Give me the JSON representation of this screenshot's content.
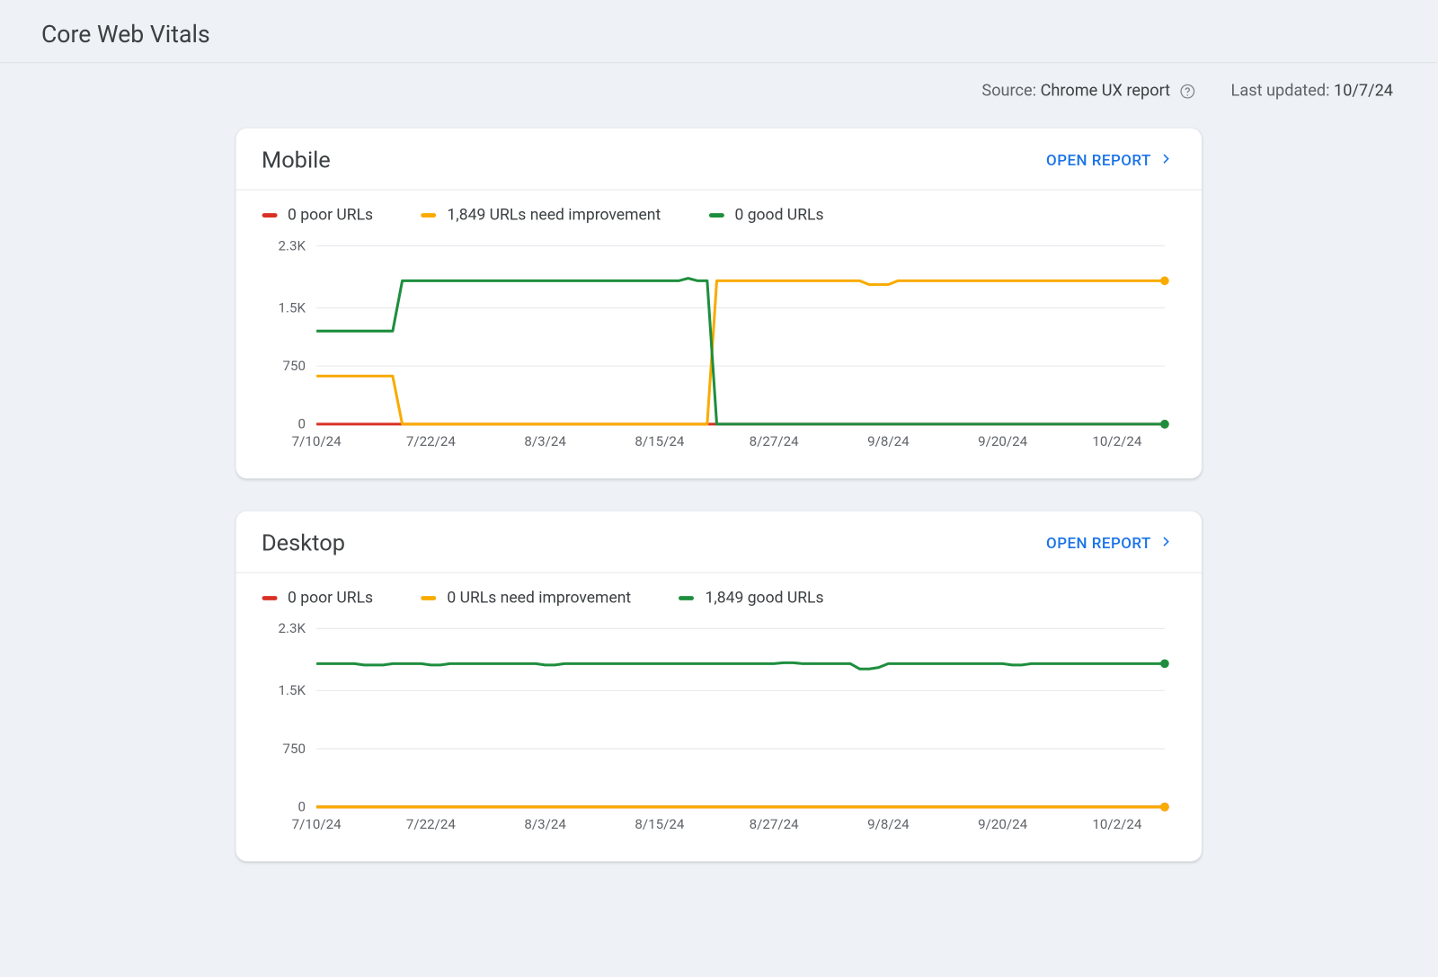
{
  "page_title": "Core Web Vitals",
  "meta": {
    "source_label": "Source:",
    "source_value": "Chrome UX report",
    "last_updated_label": "Last updated:",
    "last_updated_value": "10/7/24"
  },
  "colors": {
    "poor": "#d93025",
    "needs": "#f9ab00",
    "good": "#1e8e3e",
    "link": "#1a73e8",
    "grid": "#e8eaed",
    "axis_text": "#5f6368"
  },
  "y_ticks": [
    "2.3K",
    "1.5K",
    "750",
    "0"
  ],
  "y_tick_values": [
    2300,
    1500,
    750,
    0
  ],
  "x_ticks": [
    "7/10/24",
    "7/22/24",
    "8/3/24",
    "8/15/24",
    "8/27/24",
    "9/8/24",
    "9/20/24",
    "10/2/24"
  ],
  "cards": {
    "mobile": {
      "title": "Mobile",
      "open_report_label": "OPEN REPORT",
      "legend": {
        "poor": "0 poor URLs",
        "needs": "1,849 URLs need improvement",
        "good": "0 good URLs"
      }
    },
    "desktop": {
      "title": "Desktop",
      "open_report_label": "OPEN REPORT",
      "legend": {
        "poor": "0 poor URLs",
        "needs": "0 URLs need improvement",
        "good": "1,849 good URLs"
      }
    }
  },
  "chart_data": [
    {
      "id": "mobile",
      "type": "line",
      "title": "Mobile",
      "xlabel": "",
      "ylabel": "",
      "ylim": [
        0,
        2300
      ],
      "x": [
        "7/10/24",
        "7/11/24",
        "7/12/24",
        "7/13/24",
        "7/14/24",
        "7/15/24",
        "7/16/24",
        "7/17/24",
        "7/18/24",
        "7/19/24",
        "7/20/24",
        "7/21/24",
        "7/22/24",
        "7/23/24",
        "7/24/24",
        "7/25/24",
        "7/26/24",
        "7/27/24",
        "7/28/24",
        "7/29/24",
        "7/30/24",
        "7/31/24",
        "8/1/24",
        "8/2/24",
        "8/3/24",
        "8/4/24",
        "8/5/24",
        "8/6/24",
        "8/7/24",
        "8/8/24",
        "8/9/24",
        "8/10/24",
        "8/11/24",
        "8/12/24",
        "8/13/24",
        "8/14/24",
        "8/15/24",
        "8/16/24",
        "8/17/24",
        "8/18/24",
        "8/19/24",
        "8/20/24",
        "8/21/24",
        "8/22/24",
        "8/23/24",
        "8/24/24",
        "8/25/24",
        "8/26/24",
        "8/27/24",
        "8/28/24",
        "8/29/24",
        "8/30/24",
        "8/31/24",
        "9/1/24",
        "9/2/24",
        "9/3/24",
        "9/4/24",
        "9/5/24",
        "9/6/24",
        "9/7/24",
        "9/8/24",
        "9/9/24",
        "9/10/24",
        "9/11/24",
        "9/12/24",
        "9/13/24",
        "9/14/24",
        "9/15/24",
        "9/16/24",
        "9/17/24",
        "9/18/24",
        "9/19/24",
        "9/20/24",
        "9/21/24",
        "9/22/24",
        "9/23/24",
        "9/24/24",
        "9/25/24",
        "9/26/24",
        "9/27/24",
        "9/28/24",
        "9/29/24",
        "9/30/24",
        "10/1/24",
        "10/2/24",
        "10/3/24",
        "10/4/24",
        "10/5/24",
        "10/6/24",
        "10/7/24"
      ],
      "series": [
        {
          "name": "poor",
          "color": "#d93025",
          "values": [
            0,
            0,
            0,
            0,
            0,
            0,
            0,
            0,
            0,
            0,
            0,
            0,
            0,
            0,
            0,
            0,
            0,
            0,
            0,
            0,
            0,
            0,
            0,
            0,
            0,
            0,
            0,
            0,
            0,
            0,
            0,
            0,
            0,
            0,
            0,
            0,
            0,
            0,
            0,
            0,
            0,
            0,
            0,
            0,
            0,
            0,
            0,
            0,
            0,
            0,
            0,
            0,
            0,
            0,
            0,
            0,
            0,
            0,
            0,
            0,
            0,
            0,
            0,
            0,
            0,
            0,
            0,
            0,
            0,
            0,
            0,
            0,
            0,
            0,
            0,
            0,
            0,
            0,
            0,
            0,
            0,
            0,
            0,
            0,
            0,
            0,
            0,
            0,
            0,
            0
          ]
        },
        {
          "name": "needs_improvement",
          "color": "#f9ab00",
          "values": [
            620,
            620,
            620,
            620,
            620,
            620,
            620,
            620,
            620,
            0,
            0,
            0,
            0,
            0,
            0,
            0,
            0,
            0,
            0,
            0,
            0,
            0,
            0,
            0,
            0,
            0,
            0,
            0,
            0,
            0,
            0,
            0,
            0,
            0,
            0,
            0,
            0,
            0,
            0,
            0,
            0,
            0,
            1849,
            1849,
            1849,
            1849,
            1849,
            1849,
            1849,
            1849,
            1849,
            1849,
            1849,
            1849,
            1849,
            1849,
            1849,
            1849,
            1800,
            1800,
            1800,
            1849,
            1849,
            1849,
            1849,
            1849,
            1849,
            1849,
            1849,
            1849,
            1849,
            1849,
            1849,
            1849,
            1849,
            1849,
            1849,
            1849,
            1849,
            1849,
            1849,
            1849,
            1849,
            1849,
            1849,
            1849,
            1849,
            1849,
            1849,
            1849
          ]
        },
        {
          "name": "good",
          "color": "#1e8e3e",
          "values": [
            1200,
            1200,
            1200,
            1200,
            1200,
            1200,
            1200,
            1200,
            1200,
            1849,
            1849,
            1849,
            1849,
            1849,
            1849,
            1849,
            1849,
            1849,
            1849,
            1849,
            1849,
            1849,
            1849,
            1849,
            1849,
            1849,
            1849,
            1849,
            1849,
            1849,
            1849,
            1849,
            1849,
            1849,
            1849,
            1849,
            1849,
            1849,
            1849,
            1880,
            1849,
            1849,
            0,
            0,
            0,
            0,
            0,
            0,
            0,
            0,
            0,
            0,
            0,
            0,
            0,
            0,
            0,
            0,
            0,
            0,
            0,
            0,
            0,
            0,
            0,
            0,
            0,
            0,
            0,
            0,
            0,
            0,
            0,
            0,
            0,
            0,
            0,
            0,
            0,
            0,
            0,
            0,
            0,
            0,
            0,
            0,
            0,
            0,
            0,
            0
          ]
        }
      ]
    },
    {
      "id": "desktop",
      "type": "line",
      "title": "Desktop",
      "xlabel": "",
      "ylabel": "",
      "ylim": [
        0,
        2300
      ],
      "x": [
        "7/10/24",
        "7/11/24",
        "7/12/24",
        "7/13/24",
        "7/14/24",
        "7/15/24",
        "7/16/24",
        "7/17/24",
        "7/18/24",
        "7/19/24",
        "7/20/24",
        "7/21/24",
        "7/22/24",
        "7/23/24",
        "7/24/24",
        "7/25/24",
        "7/26/24",
        "7/27/24",
        "7/28/24",
        "7/29/24",
        "7/30/24",
        "7/31/24",
        "8/1/24",
        "8/2/24",
        "8/3/24",
        "8/4/24",
        "8/5/24",
        "8/6/24",
        "8/7/24",
        "8/8/24",
        "8/9/24",
        "8/10/24",
        "8/11/24",
        "8/12/24",
        "8/13/24",
        "8/14/24",
        "8/15/24",
        "8/16/24",
        "8/17/24",
        "8/18/24",
        "8/19/24",
        "8/20/24",
        "8/21/24",
        "8/22/24",
        "8/23/24",
        "8/24/24",
        "8/25/24",
        "8/26/24",
        "8/27/24",
        "8/28/24",
        "8/29/24",
        "8/30/24",
        "8/31/24",
        "9/1/24",
        "9/2/24",
        "9/3/24",
        "9/4/24",
        "9/5/24",
        "9/6/24",
        "9/7/24",
        "9/8/24",
        "9/9/24",
        "9/10/24",
        "9/11/24",
        "9/12/24",
        "9/13/24",
        "9/14/24",
        "9/15/24",
        "9/16/24",
        "9/17/24",
        "9/18/24",
        "9/19/24",
        "9/20/24",
        "9/21/24",
        "9/22/24",
        "9/23/24",
        "9/24/24",
        "9/25/24",
        "9/26/24",
        "9/27/24",
        "9/28/24",
        "9/29/24",
        "9/30/24",
        "10/1/24",
        "10/2/24",
        "10/3/24",
        "10/4/24",
        "10/5/24",
        "10/6/24",
        "10/7/24"
      ],
      "series": [
        {
          "name": "poor",
          "color": "#d93025",
          "values": [
            0,
            0,
            0,
            0,
            0,
            0,
            0,
            0,
            0,
            0,
            0,
            0,
            0,
            0,
            0,
            0,
            0,
            0,
            0,
            0,
            0,
            0,
            0,
            0,
            0,
            0,
            0,
            0,
            0,
            0,
            0,
            0,
            0,
            0,
            0,
            0,
            0,
            0,
            0,
            0,
            0,
            0,
            0,
            0,
            0,
            0,
            0,
            0,
            0,
            0,
            0,
            0,
            0,
            0,
            0,
            0,
            0,
            0,
            0,
            0,
            0,
            0,
            0,
            0,
            0,
            0,
            0,
            0,
            0,
            0,
            0,
            0,
            0,
            0,
            0,
            0,
            0,
            0,
            0,
            0,
            0,
            0,
            0,
            0,
            0,
            0,
            0,
            0,
            0,
            0
          ]
        },
        {
          "name": "needs_improvement",
          "color": "#f9ab00",
          "values": [
            0,
            0,
            0,
            0,
            0,
            0,
            0,
            0,
            0,
            0,
            0,
            0,
            0,
            0,
            0,
            0,
            0,
            0,
            0,
            0,
            0,
            0,
            0,
            0,
            0,
            0,
            0,
            0,
            0,
            0,
            0,
            0,
            0,
            0,
            0,
            0,
            0,
            0,
            0,
            0,
            0,
            0,
            0,
            0,
            0,
            0,
            0,
            0,
            0,
            0,
            0,
            0,
            0,
            0,
            0,
            0,
            0,
            0,
            0,
            0,
            0,
            0,
            0,
            0,
            0,
            0,
            0,
            0,
            0,
            0,
            0,
            0,
            0,
            0,
            0,
            0,
            0,
            0,
            0,
            0,
            0,
            0,
            0,
            0,
            0,
            0,
            0,
            0,
            0,
            0
          ]
        },
        {
          "name": "good",
          "color": "#1e8e3e",
          "values": [
            1849,
            1849,
            1849,
            1849,
            1849,
            1830,
            1830,
            1830,
            1849,
            1849,
            1849,
            1849,
            1830,
            1830,
            1849,
            1849,
            1849,
            1849,
            1849,
            1849,
            1849,
            1849,
            1849,
            1849,
            1830,
            1830,
            1849,
            1849,
            1849,
            1849,
            1849,
            1849,
            1849,
            1849,
            1849,
            1849,
            1849,
            1849,
            1849,
            1849,
            1849,
            1849,
            1849,
            1849,
            1849,
            1849,
            1849,
            1849,
            1849,
            1860,
            1860,
            1849,
            1849,
            1849,
            1849,
            1849,
            1849,
            1780,
            1780,
            1800,
            1849,
            1849,
            1849,
            1849,
            1849,
            1849,
            1849,
            1849,
            1849,
            1849,
            1849,
            1849,
            1849,
            1830,
            1830,
            1849,
            1849,
            1849,
            1849,
            1849,
            1849,
            1849,
            1849,
            1849,
            1849,
            1849,
            1849,
            1849,
            1849,
            1849
          ]
        }
      ]
    }
  ]
}
